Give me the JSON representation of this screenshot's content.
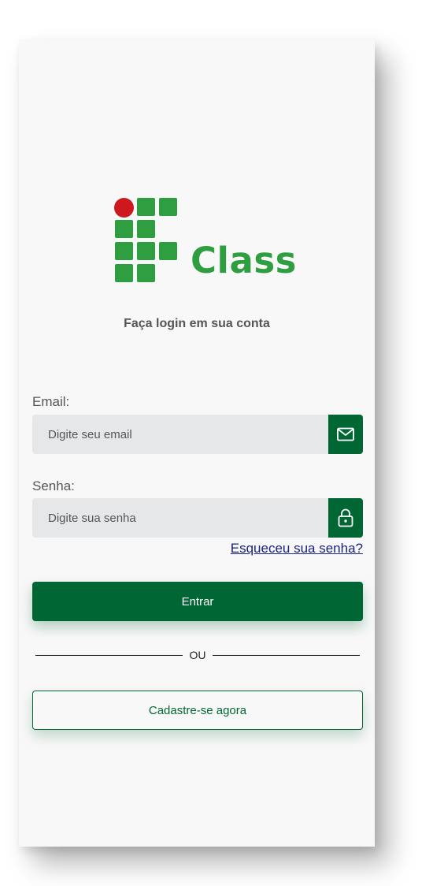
{
  "brand": {
    "name": "Class",
    "green": "#2f9e41",
    "red": "#cd191e",
    "dark_green": "#006633"
  },
  "subtitle": "Faça login em sua conta",
  "email": {
    "label": "Email:",
    "placeholder": "Digite seu email",
    "value": "",
    "icon": "mail-icon"
  },
  "password": {
    "label": "Senha:",
    "placeholder": "Digite sua senha",
    "value": "",
    "icon": "lock-icon"
  },
  "forgot_link": "Esqueceu sua senha?",
  "login_button": "Entrar",
  "divider_text": "OU",
  "signup_button": "Cadastre-se agora"
}
